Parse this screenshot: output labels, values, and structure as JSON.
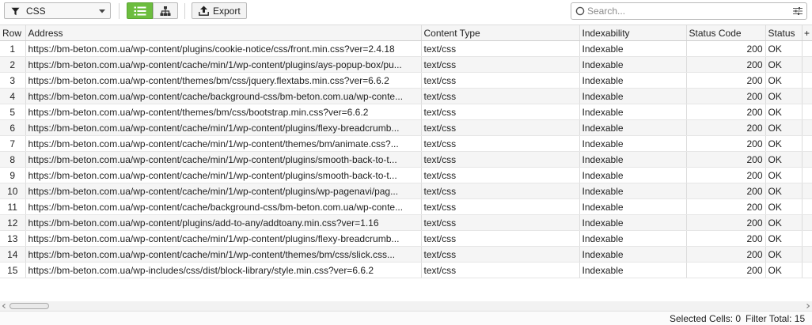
{
  "toolbar": {
    "filter_value": "CSS",
    "export_label": "Export",
    "search_placeholder": "Search..."
  },
  "columns": [
    "Row",
    "Address",
    "Content Type",
    "Indexability",
    "Status Code",
    "Status"
  ],
  "add_column_glyph": "+",
  "rows": [
    {
      "row": "1",
      "address": "https://bm-beton.com.ua/wp-content/plugins/cookie-notice/css/front.min.css?ver=2.4.18",
      "content_type": "text/css",
      "indexability": "Indexable",
      "status_code": "200",
      "status": "OK"
    },
    {
      "row": "2",
      "address": "https://bm-beton.com.ua/wp-content/cache/min/1/wp-content/plugins/ays-popup-box/pu...",
      "content_type": "text/css",
      "indexability": "Indexable",
      "status_code": "200",
      "status": "OK"
    },
    {
      "row": "3",
      "address": "https://bm-beton.com.ua/wp-content/themes/bm/css/jquery.flextabs.min.css?ver=6.6.2",
      "content_type": "text/css",
      "indexability": "Indexable",
      "status_code": "200",
      "status": "OK"
    },
    {
      "row": "4",
      "address": "https://bm-beton.com.ua/wp-content/cache/background-css/bm-beton.com.ua/wp-conte...",
      "content_type": "text/css",
      "indexability": "Indexable",
      "status_code": "200",
      "status": "OK"
    },
    {
      "row": "5",
      "address": "https://bm-beton.com.ua/wp-content/themes/bm/css/bootstrap.min.css?ver=6.6.2",
      "content_type": "text/css",
      "indexability": "Indexable",
      "status_code": "200",
      "status": "OK"
    },
    {
      "row": "6",
      "address": "https://bm-beton.com.ua/wp-content/cache/min/1/wp-content/plugins/flexy-breadcrumb...",
      "content_type": "text/css",
      "indexability": "Indexable",
      "status_code": "200",
      "status": "OK"
    },
    {
      "row": "7",
      "address": "https://bm-beton.com.ua/wp-content/cache/min/1/wp-content/themes/bm/animate.css?...",
      "content_type": "text/css",
      "indexability": "Indexable",
      "status_code": "200",
      "status": "OK"
    },
    {
      "row": "8",
      "address": "https://bm-beton.com.ua/wp-content/cache/min/1/wp-content/plugins/smooth-back-to-t...",
      "content_type": "text/css",
      "indexability": "Indexable",
      "status_code": "200",
      "status": "OK"
    },
    {
      "row": "9",
      "address": "https://bm-beton.com.ua/wp-content/cache/min/1/wp-content/plugins/smooth-back-to-t...",
      "content_type": "text/css",
      "indexability": "Indexable",
      "status_code": "200",
      "status": "OK"
    },
    {
      "row": "10",
      "address": "https://bm-beton.com.ua/wp-content/cache/min/1/wp-content/plugins/wp-pagenavi/pag...",
      "content_type": "text/css",
      "indexability": "Indexable",
      "status_code": "200",
      "status": "OK"
    },
    {
      "row": "11",
      "address": "https://bm-beton.com.ua/wp-content/cache/background-css/bm-beton.com.ua/wp-conte...",
      "content_type": "text/css",
      "indexability": "Indexable",
      "status_code": "200",
      "status": "OK"
    },
    {
      "row": "12",
      "address": "https://bm-beton.com.ua/wp-content/plugins/add-to-any/addtoany.min.css?ver=1.16",
      "content_type": "text/css",
      "indexability": "Indexable",
      "status_code": "200",
      "status": "OK"
    },
    {
      "row": "13",
      "address": "https://bm-beton.com.ua/wp-content/cache/min/1/wp-content/plugins/flexy-breadcrumb...",
      "content_type": "text/css",
      "indexability": "Indexable",
      "status_code": "200",
      "status": "OK"
    },
    {
      "row": "14",
      "address": "https://bm-beton.com.ua/wp-content/cache/min/1/wp-content/themes/bm/css/slick.css...",
      "content_type": "text/css",
      "indexability": "Indexable",
      "status_code": "200",
      "status": "OK"
    },
    {
      "row": "15",
      "address": "https://bm-beton.com.ua/wp-includes/css/dist/block-library/style.min.css?ver=6.6.2",
      "content_type": "text/css",
      "indexability": "Indexable",
      "status_code": "200",
      "status": "OK"
    }
  ],
  "statusbar": {
    "selected_cells": "Selected Cells:  0",
    "filter_total": "Filter Total:  15"
  },
  "colors": {
    "accent_green": "#6cbd3e",
    "row_alt": "#f5f5f5",
    "header_bg": "#f5f5f5"
  },
  "icons": [
    "filter-funnel-icon",
    "chevron-down-icon",
    "list-view-icon",
    "tree-view-icon",
    "export-icon",
    "search-icon",
    "search-options-icon",
    "add-column-icon",
    "scroll-left-icon",
    "scroll-right-icon"
  ]
}
